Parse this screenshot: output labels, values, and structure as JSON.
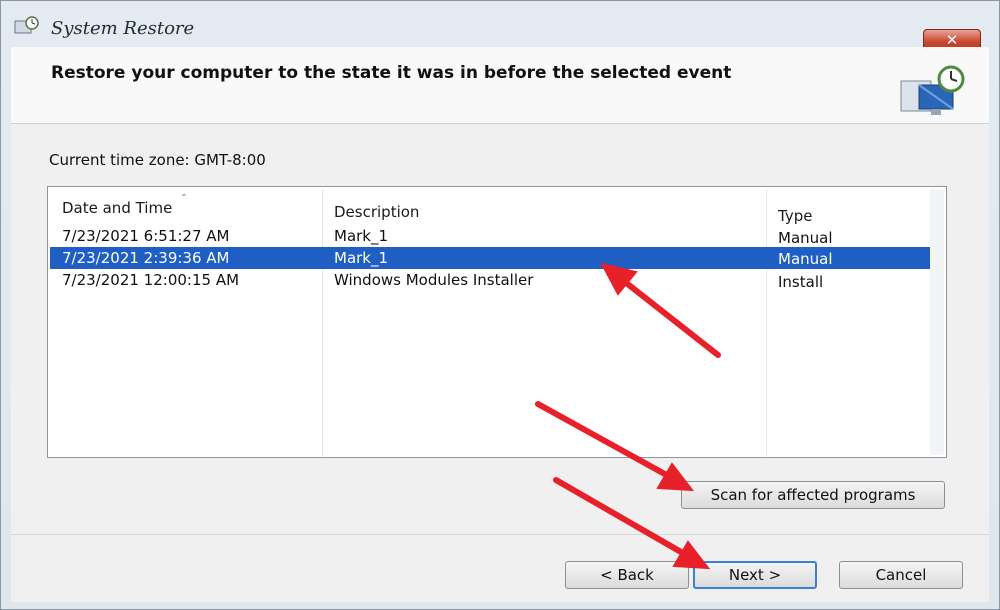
{
  "window": {
    "title": "System Restore",
    "close_label": "✕"
  },
  "header": {
    "text": "Restore your computer to the state it was in before the selected event"
  },
  "timezone": {
    "label": "Current time zone: GMT-8:00"
  },
  "restore_list": {
    "columns": [
      "Date and Time",
      "Description",
      "Type"
    ],
    "rows": [
      {
        "date": "7/23/2021 6:51:27 AM",
        "description": "Mark_1",
        "type": "Manual",
        "selected": false
      },
      {
        "date": "7/23/2021 2:39:36 AM",
        "description": "Mark_1",
        "type": "Manual",
        "selected": true
      },
      {
        "date": "7/23/2021 12:00:15 AM",
        "description": "Windows Modules Installer",
        "type": "Install",
        "selected": false
      }
    ]
  },
  "buttons": {
    "scan": "Scan for affected programs",
    "back": "< Back",
    "next": "Next >",
    "cancel": "Cancel"
  },
  "colors": {
    "selection": "#1f5fc4",
    "annotation_arrow": "#e8202a",
    "close_button": "#c9452f"
  }
}
